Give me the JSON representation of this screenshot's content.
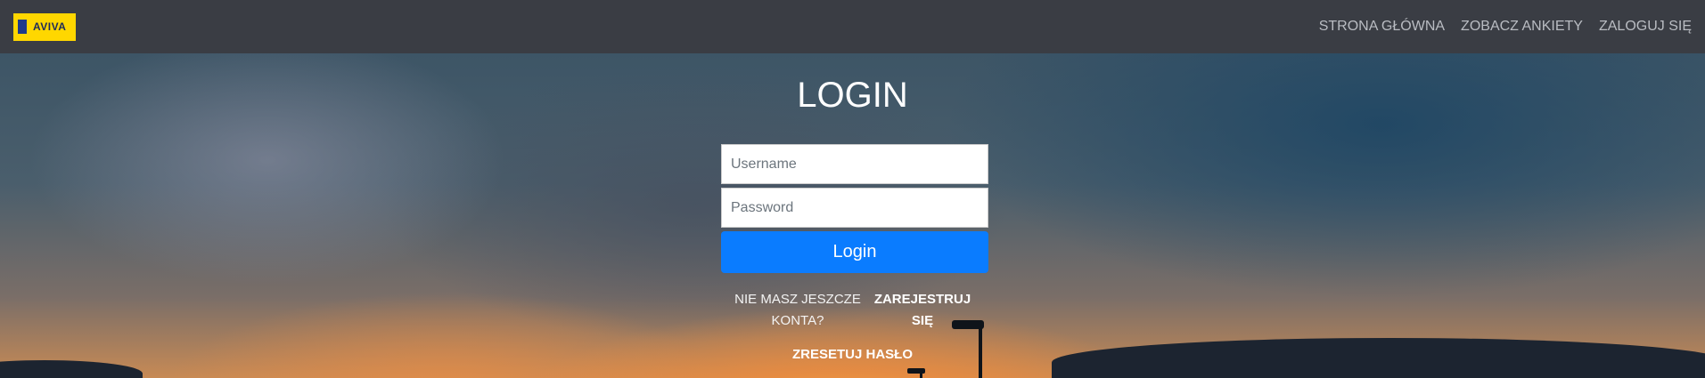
{
  "navbar": {
    "logo_text": "AVIVA",
    "links": [
      {
        "label": "STRONA GŁÓWNA"
      },
      {
        "label": "ZOBACZ ANKIETY"
      },
      {
        "label": "ZALOGUJ SIĘ"
      }
    ]
  },
  "login": {
    "title": "LOGIN",
    "username_placeholder": "Username",
    "username_value": "",
    "password_placeholder": "Password",
    "password_value": "",
    "submit_label": "Login",
    "no_account_text": "NIE MASZ JESZCZE KONTA?",
    "register_label": "ZAREJESTRUJ SIĘ",
    "reset_label": "ZRESETUJ HASŁO"
  },
  "colors": {
    "navbar_bg": "#3a3d44",
    "logo_bg": "#ffd700",
    "button_bg": "#0a7cff"
  }
}
